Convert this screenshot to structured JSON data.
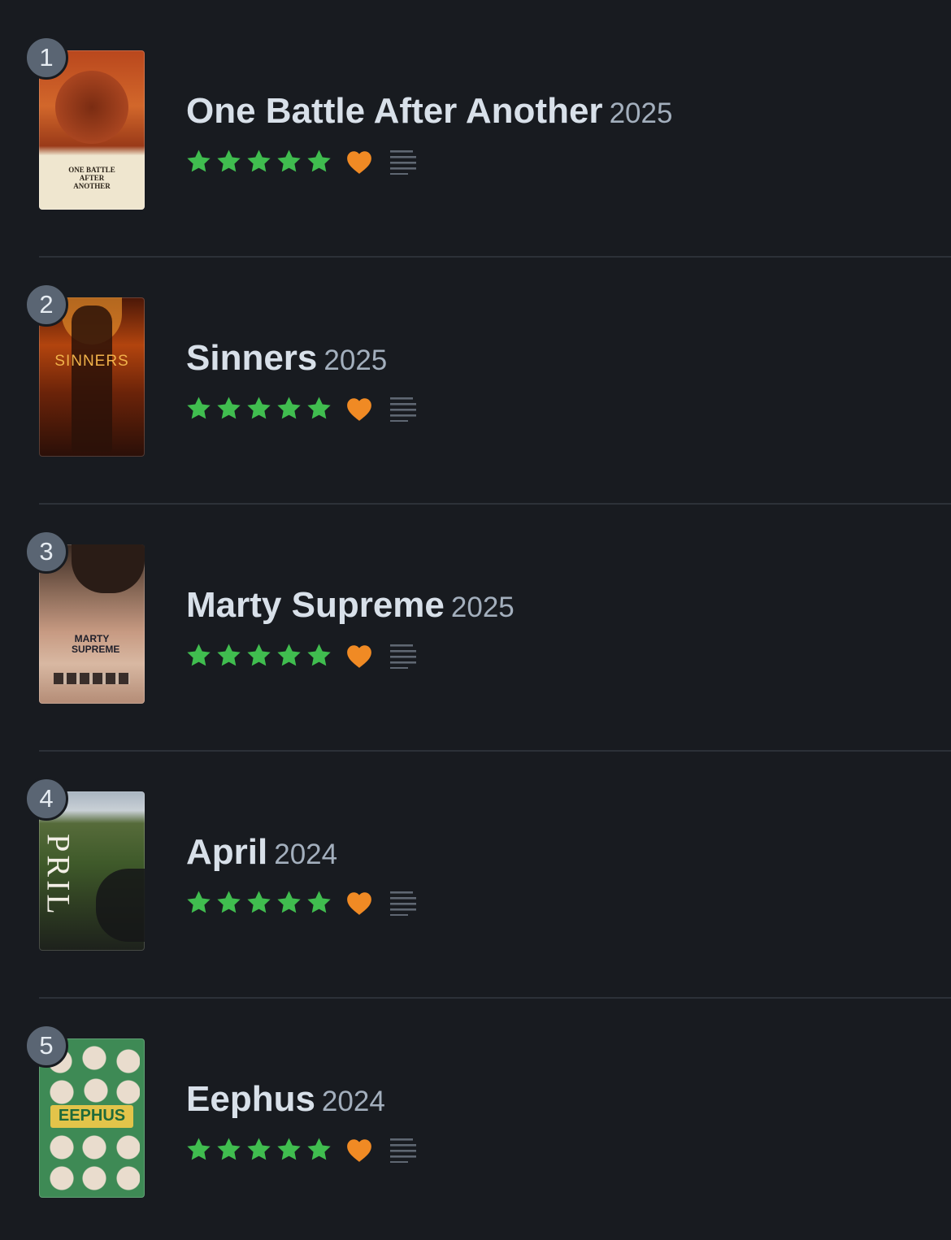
{
  "colors": {
    "background": "#181b20",
    "star": "#40bd4f",
    "heart": "#f08a24",
    "badge": "#5a6573"
  },
  "films": [
    {
      "rank": "1",
      "title": "One Battle After Another",
      "year": "2025",
      "rating": 5,
      "liked": true,
      "has_review": true,
      "poster_text": "ONE BATTLE AFTER ANOTHER"
    },
    {
      "rank": "2",
      "title": "Sinners",
      "year": "2025",
      "rating": 5,
      "liked": true,
      "has_review": true,
      "poster_text": "SINNERS"
    },
    {
      "rank": "3",
      "title": "Marty Supreme",
      "year": "2025",
      "rating": 5,
      "liked": true,
      "has_review": true,
      "poster_text": "MARTY SUPREME"
    },
    {
      "rank": "4",
      "title": "April",
      "year": "2024",
      "rating": 5,
      "liked": true,
      "has_review": true,
      "poster_text": "PRIL"
    },
    {
      "rank": "5",
      "title": "Eephus",
      "year": "2024",
      "rating": 5,
      "liked": true,
      "has_review": true,
      "poster_text": "EEPHUS"
    }
  ]
}
